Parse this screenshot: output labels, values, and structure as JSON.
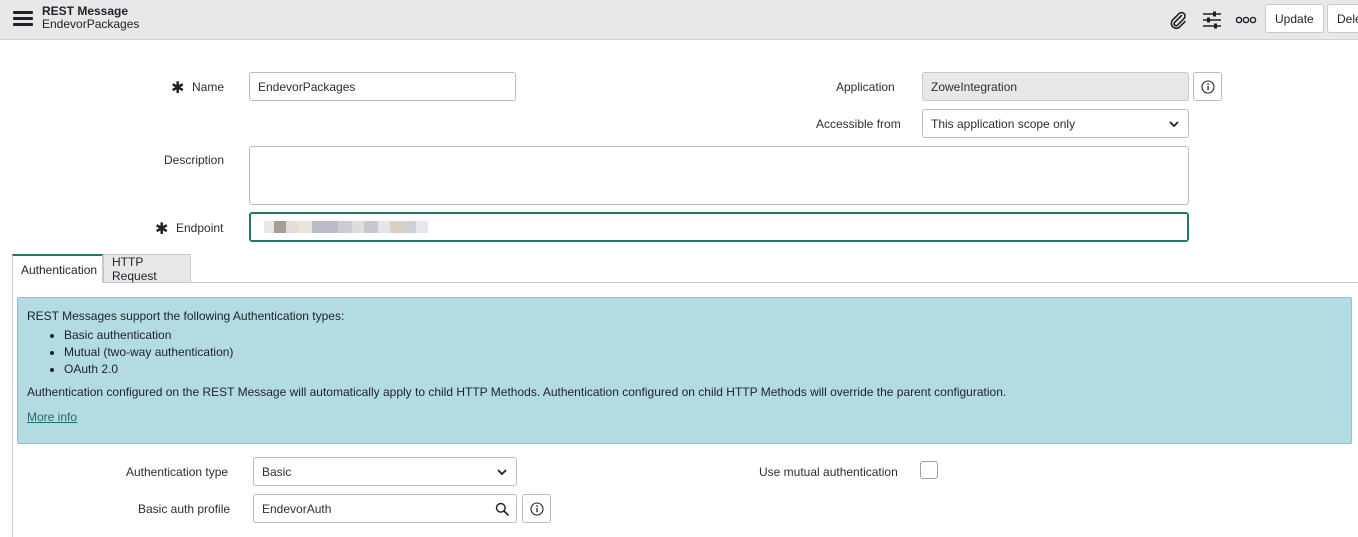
{
  "header": {
    "record_type": "REST Message",
    "record_name": "EndevorPackages",
    "update_label": "Update",
    "delete_label": "Dele"
  },
  "form": {
    "name_label": "Name",
    "name_value": "EndevorPackages",
    "description_label": "Description",
    "description_value": "",
    "endpoint_label": "Endpoint",
    "endpoint_value": "",
    "application_label": "Application",
    "application_value": "ZoweIntegration",
    "accessible_label": "Accessible from",
    "accessible_value": "This application scope only",
    "required_marker": "✱"
  },
  "tabs": [
    {
      "label": "Authentication",
      "active": true
    },
    {
      "label": "HTTP Request",
      "active": false
    }
  ],
  "infobox": {
    "intro": "REST Messages support the following Authentication types:",
    "types": [
      "Basic authentication",
      "Mutual (two-way authentication)",
      "OAuth 2.0"
    ],
    "note": "Authentication configured on the REST Message will automatically apply to child HTTP Methods. Authentication configured on child HTTP Methods will override the parent configuration.",
    "link": "More info"
  },
  "auth": {
    "type_label": "Authentication type",
    "type_value": "Basic",
    "profile_label": "Basic auth profile",
    "profile_value": "EndevorAuth",
    "mutual_label": "Use mutual authentication",
    "mutual_checked": false
  },
  "colors": {
    "accent": "#1b7a68",
    "info_bg": "#b2dce2",
    "header_bg": "#e6e8ea"
  }
}
